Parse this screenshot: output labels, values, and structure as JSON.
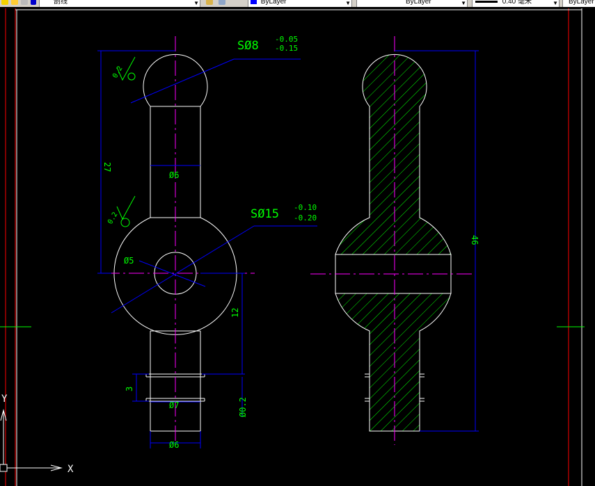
{
  "toolbar": {
    "layer_name": "剖线",
    "color_label": "ByLayer",
    "linetype_label": "ByLayer",
    "lineweight_label": "0.40 毫米",
    "plotstyle_label": "ByLayer"
  },
  "dimensions": {
    "sphere_small": {
      "prefix": "SØ8",
      "upper_tol": "-0.05",
      "lower_tol": "-0.15"
    },
    "sphere_large": {
      "prefix": "SØ15",
      "upper_tol": "-0.10",
      "lower_tol": "-0.20"
    },
    "roughness_1": "0.2",
    "roughness_2": "0.2",
    "length_27": "27",
    "dia_6_shaft": "Ø6",
    "dia_5_hole": "Ø5",
    "len_12": "12",
    "len_3": "3",
    "dia_7_groove": "Ø7",
    "dia_6_bottom": "Ø6",
    "tol_02": "Ø0.2",
    "total_46": "46"
  },
  "ucs": {
    "x_label": "X",
    "y_label": "Y"
  },
  "colors": {
    "background": "#000000",
    "outline": "#ffffff",
    "dimension": "#0000ff",
    "dim_text": "#00ff00",
    "centerline": "#ff00ff",
    "hatch": "#00ff00",
    "border": "#ff0000"
  }
}
